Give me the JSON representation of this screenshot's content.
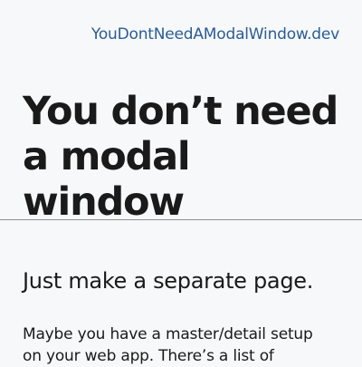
{
  "header": {
    "site_link": "YouDontNeedAModalWindow.dev"
  },
  "main": {
    "title": "You don’t need a modal window",
    "subtitle": "Just make a separate page.",
    "intro": "Maybe you have a master/detail setup on your web app. There’s a list of"
  },
  "colors": {
    "background": "#f7f8fa",
    "text": "#1a1a1a",
    "link": "#2a5d94",
    "divider": "#8f8f8f"
  }
}
